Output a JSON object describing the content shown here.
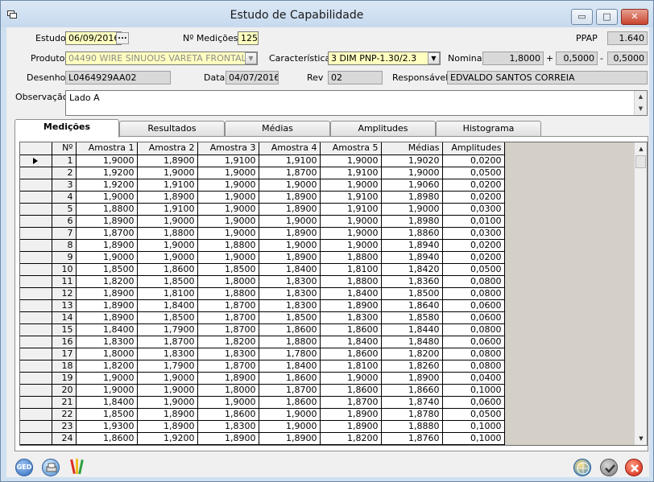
{
  "window": {
    "title": "Estudo de Capabilidade",
    "minimize_glyph": "▭",
    "maximize_glyph": "□",
    "close_glyph": "✕"
  },
  "form": {
    "estudo_label": "Estudo",
    "estudo_value": "06/09/2016",
    "estudo_btn": "...",
    "nmed_label": "Nº Medições",
    "nmed_value": "125",
    "ppap_label": "PPAP",
    "ppap_value": "1.640",
    "produto_label": "Produto",
    "produto_value": "04490  WIRE SINUOUS VARETA FRONTAL",
    "caracteristica_label": "Característica",
    "caracteristica_value": "3  DIM   PNP-1.30/2.3",
    "nominal_label": "Nominal",
    "nominal_value": "1,8000",
    "plus_sign": "+",
    "tol_plus": "0,5000",
    "minus_sign": "-",
    "tol_minus": "0,5000",
    "desenho_label": "Desenho",
    "desenho_value": "L0464929AA02",
    "data_label": "Data",
    "data_value": "04/07/2016",
    "rev_label": "Rev",
    "rev_value": "02",
    "responsavel_label": "Responsável",
    "responsavel_value": "EDVALDO SANTOS CORREIA",
    "observacao_label": "Observação",
    "observacao_value": "Lado A"
  },
  "tabs": [
    {
      "label": "Medições",
      "active": true
    },
    {
      "label": "Resultados",
      "active": false
    },
    {
      "label": "Médias",
      "active": false
    },
    {
      "label": "Amplitudes",
      "active": false
    },
    {
      "label": "Histograma",
      "active": false
    }
  ],
  "grid": {
    "columns": [
      "Nº",
      "Amostra 1",
      "Amostra 2",
      "Amostra 3",
      "Amostra 4",
      "Amostra 5",
      "Médias",
      "Amplitudes"
    ],
    "rows": [
      [
        "1",
        "1,9000",
        "1,8900",
        "1,9100",
        "1,9100",
        "1,9000",
        "1,9020",
        "0,0200"
      ],
      [
        "2",
        "1,9200",
        "1,9000",
        "1,9000",
        "1,8700",
        "1,9100",
        "1,9000",
        "0,0500"
      ],
      [
        "3",
        "1,9200",
        "1,9100",
        "1,9000",
        "1,9000",
        "1,9000",
        "1,9060",
        "0,0200"
      ],
      [
        "4",
        "1,9000",
        "1,8900",
        "1,9000",
        "1,8900",
        "1,9100",
        "1,8980",
        "0,0200"
      ],
      [
        "5",
        "1,8800",
        "1,9100",
        "1,9000",
        "1,8900",
        "1,9100",
        "1,9000",
        "0,0300"
      ],
      [
        "6",
        "1,8900",
        "1,9000",
        "1,9000",
        "1,9000",
        "1,9000",
        "1,8980",
        "0,0100"
      ],
      [
        "7",
        "1,8700",
        "1,8800",
        "1,9000",
        "1,8900",
        "1,9000",
        "1,8860",
        "0,0300"
      ],
      [
        "8",
        "1,8900",
        "1,9000",
        "1,8800",
        "1,9000",
        "1,9000",
        "1,8940",
        "0,0200"
      ],
      [
        "9",
        "1,9000",
        "1,9000",
        "1,9000",
        "1,8900",
        "1,8800",
        "1,8940",
        "0,0200"
      ],
      [
        "10",
        "1,8500",
        "1,8600",
        "1,8500",
        "1,8400",
        "1,8100",
        "1,8420",
        "0,0500"
      ],
      [
        "11",
        "1,8200",
        "1,8500",
        "1,8000",
        "1,8300",
        "1,8800",
        "1,8360",
        "0,0800"
      ],
      [
        "12",
        "1,8900",
        "1,8100",
        "1,8800",
        "1,8300",
        "1,8400",
        "1,8500",
        "0,0800"
      ],
      [
        "13",
        "1,8900",
        "1,8400",
        "1,8700",
        "1,8300",
        "1,8900",
        "1,8640",
        "0,0600"
      ],
      [
        "14",
        "1,8900",
        "1,8500",
        "1,8700",
        "1,8500",
        "1,8300",
        "1,8580",
        "0,0600"
      ],
      [
        "15",
        "1,8400",
        "1,7900",
        "1,8700",
        "1,8600",
        "1,8600",
        "1,8440",
        "0,0800"
      ],
      [
        "16",
        "1,8300",
        "1,8700",
        "1,8200",
        "1,8800",
        "1,8400",
        "1,8480",
        "0,0600"
      ],
      [
        "17",
        "1,8000",
        "1,8300",
        "1,8300",
        "1,7800",
        "1,8600",
        "1,8200",
        "0,0800"
      ],
      [
        "18",
        "1,8200",
        "1,7900",
        "1,8700",
        "1,8400",
        "1,8100",
        "1,8260",
        "0,0800"
      ],
      [
        "19",
        "1,9000",
        "1,9000",
        "1,8900",
        "1,8600",
        "1,9000",
        "1,8900",
        "0,0400"
      ],
      [
        "20",
        "1,9000",
        "1,9000",
        "1,8000",
        "1,8700",
        "1,8600",
        "1,8660",
        "0,1000"
      ],
      [
        "21",
        "1,8400",
        "1,9000",
        "1,9000",
        "1,8600",
        "1,8700",
        "1,8740",
        "0,0600"
      ],
      [
        "22",
        "1,8500",
        "1,8900",
        "1,8600",
        "1,9000",
        "1,8900",
        "1,8780",
        "0,0500"
      ],
      [
        "23",
        "1,9300",
        "1,8900",
        "1,8300",
        "1,9000",
        "1,8900",
        "1,8880",
        "0,1000"
      ],
      [
        "24",
        "1,8600",
        "1,9200",
        "1,8900",
        "1,8900",
        "1,8200",
        "1,8760",
        "0,1000"
      ]
    ],
    "current_row": 1
  },
  "bottom": {
    "ged_label": "GED"
  },
  "colors": {
    "required_field": "#ffffc0",
    "readonly_field": "#d9d9d9",
    "confirm": "#8a8a8a",
    "cancel": "#e0301e"
  }
}
